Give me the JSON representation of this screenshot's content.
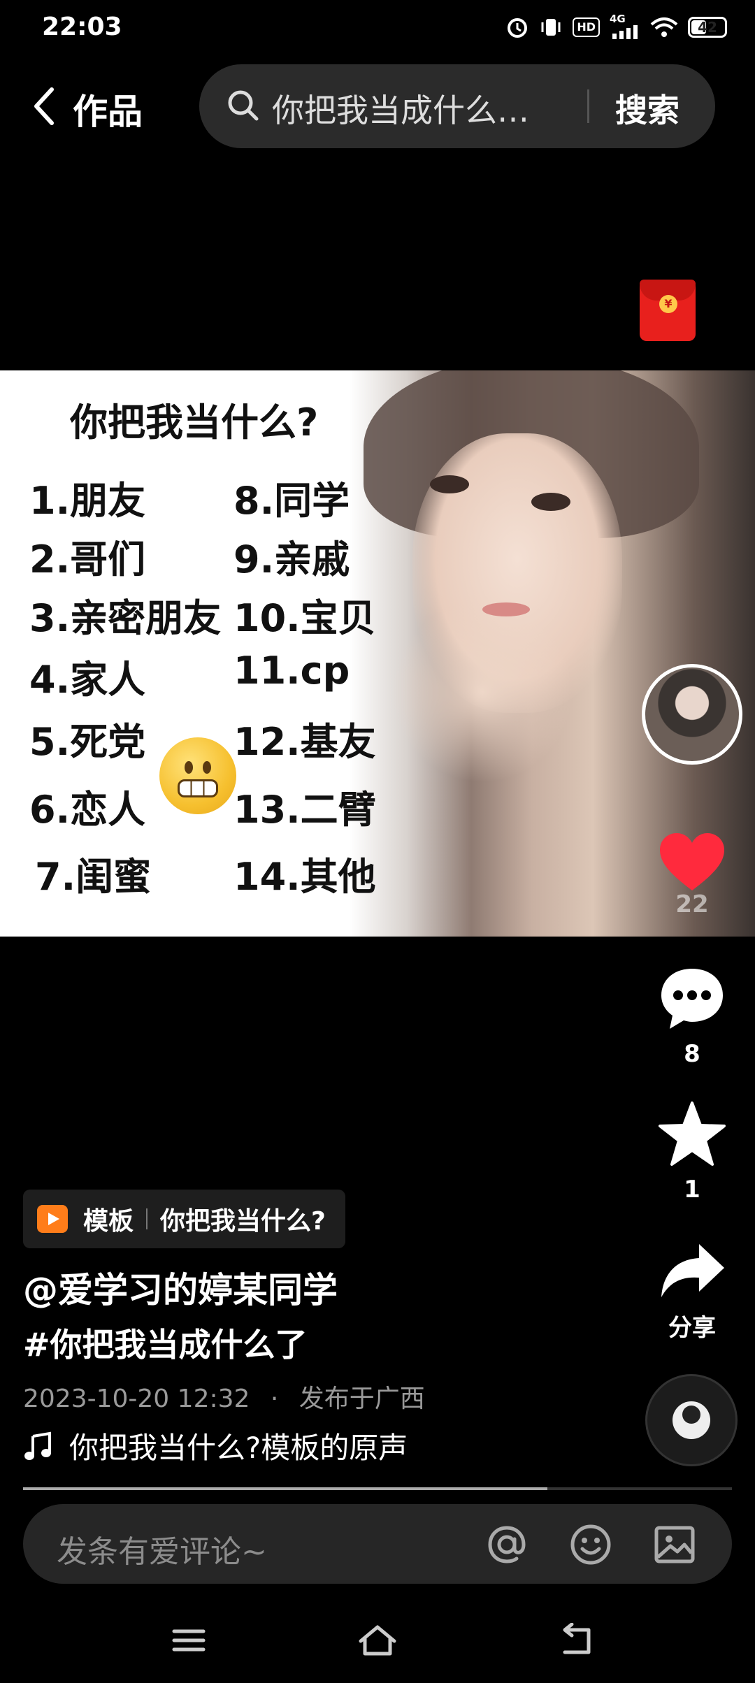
{
  "status_bar": {
    "time": "22:03",
    "network": "4G",
    "hd_badge": "HD",
    "battery": "42",
    "icons": [
      "alarm-icon",
      "vibrate-icon",
      "hd-icon",
      "signal-icon",
      "wifi-icon",
      "battery-icon"
    ]
  },
  "header": {
    "title": "作品",
    "search_text": "你把我当成什么…",
    "search_button": "搜索"
  },
  "video": {
    "title": "你把我当什么?",
    "items": [
      "1.朋友",
      "2.哥们",
      "3.亲密朋友",
      "4.家人",
      "5.死党",
      "6.恋人",
      "7.闺蜜",
      "8.同学",
      "9.亲戚",
      "10.宝贝",
      "11.cp",
      "12.基友",
      "13.二臂",
      "14.其他"
    ]
  },
  "actions": {
    "like_count": "22",
    "comment_count": "8",
    "favorite_count": "1",
    "share_label": "分享"
  },
  "post": {
    "template_label": "模板",
    "template_name": "你把我当什么?",
    "author": "@爱学习的婷某同学",
    "hashtag": "#你把我当成什么了",
    "date": "2023-10-20 12:32",
    "dot": "·",
    "location": "发布于广西",
    "music": "你把我当什么?模板的原声"
  },
  "playback": {
    "progress": 0.74
  },
  "comment_bar": {
    "placeholder": "发条有爱评论~"
  },
  "colors": {
    "background": "#000000",
    "like_red": "#ff2a3d",
    "template_orange": "#ff7d1a",
    "red_packet": "#e8201d"
  }
}
